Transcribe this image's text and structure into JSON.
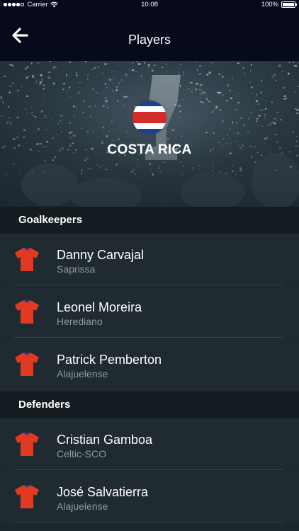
{
  "status_bar": {
    "carrier": "Carrier",
    "time": "10:08",
    "battery": "100%",
    "battery_level": 1.0,
    "signal_bars_filled": 4,
    "signal_bars_total": 5,
    "icons": [
      "signal-icon",
      "wifi-icon",
      "battery-icon"
    ]
  },
  "nav": {
    "title": "Players",
    "back_icon": "arrow-left-icon"
  },
  "team": {
    "name": "COSTA RICA",
    "flag_colors": [
      "#1d3e8c",
      "#ffffff",
      "#d52a2a",
      "#ffffff",
      "#1d3e8c"
    ]
  },
  "colors": {
    "nav_background": "#060a1a",
    "section_background": "#141c21",
    "row_background": "#1f2a31",
    "club_text": "#8b9aa4",
    "jersey_red": "#e23a22",
    "jersey_collar": "#2a3e9a"
  },
  "sections": [
    {
      "title": "Goalkeepers",
      "players": [
        {
          "name": "Danny Carvajal",
          "club": "Saprissa"
        },
        {
          "name": "Leonel Moreira",
          "club": "Herediano"
        },
        {
          "name": "Patrick Pemberton",
          "club": "Alajuelense"
        }
      ]
    },
    {
      "title": "Defenders",
      "players": [
        {
          "name": "Cristian Gamboa",
          "club": "Celtic-SCO"
        },
        {
          "name": "José Salvatierra",
          "club": "Alajuelense"
        }
      ]
    }
  ]
}
